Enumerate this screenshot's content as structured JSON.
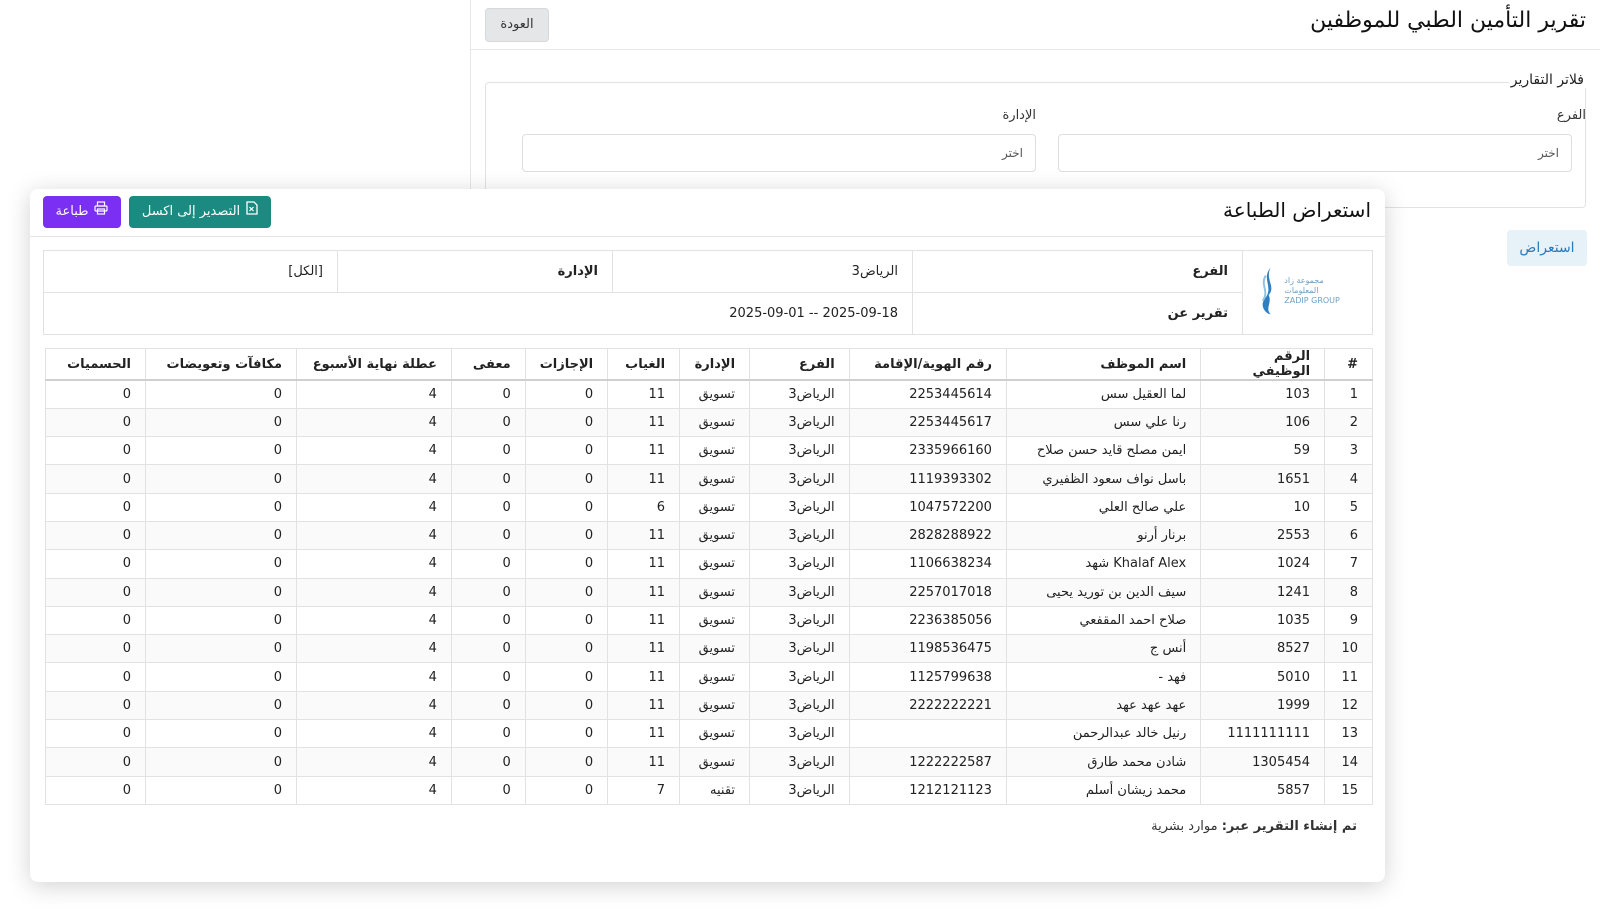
{
  "page": {
    "title": "تقرير التأمين الطبي للموظفين",
    "back_label": "العودة",
    "filters_title": "فلاتر التقارير",
    "branch_label": "الفرع",
    "branch_placeholder": "اختر",
    "department_label": "الإدارة",
    "department_placeholder": "اختر",
    "preview_label": "استعراض"
  },
  "modal": {
    "title": "استعراض الطباعة",
    "export_label": "التصدير إلى اكسل",
    "print_label": "طباعة",
    "logo_text_ar": "مجموعة زاد المعلومات",
    "logo_text_en": "ZADIP GROUP",
    "info": {
      "branch_label": "الفرع",
      "branch_value": "الرياض3",
      "department_label": "الإدارة",
      "department_value": "[الكل]",
      "report_label": "تقرير عن",
      "report_value": "2025-09-01 -- 2025-09-18"
    },
    "columns": [
      "#",
      "الرقم الوظيفي",
      "اسم الموظف",
      "رقم الهوية/الإقامة",
      "الفرع",
      "الإدارة",
      "الغياب",
      "الإجازات",
      "معفى",
      "عطلة نهاية الأسبوع",
      "مكافآت وتعويضات",
      "الحسميات"
    ],
    "rows": [
      [
        "1",
        "103",
        "لما العقيل سس",
        "2253445614",
        "الرياض3",
        "تسويق",
        "11",
        "0",
        "0",
        "4",
        "0",
        "0"
      ],
      [
        "2",
        "106",
        "رنا علي سس",
        "2253445617",
        "الرياض3",
        "تسويق",
        "11",
        "0",
        "0",
        "4",
        "0",
        "0"
      ],
      [
        "3",
        "59",
        "ايمن مصلح قايد حسن صلاح",
        "2335966160",
        "الرياض3",
        "تسويق",
        "11",
        "0",
        "0",
        "4",
        "0",
        "0"
      ],
      [
        "4",
        "1651",
        "باسل نواف سعود الظفيري",
        "1119393302",
        "الرياض3",
        "تسويق",
        "11",
        "0",
        "0",
        "4",
        "0",
        "0"
      ],
      [
        "5",
        "10",
        "علي صالح العلي",
        "1047572200",
        "الرياض3",
        "تسويق",
        "6",
        "0",
        "0",
        "4",
        "0",
        "0"
      ],
      [
        "6",
        "2553",
        "برنار أرنو",
        "2828288922",
        "الرياض3",
        "تسويق",
        "11",
        "0",
        "0",
        "4",
        "0",
        "0"
      ],
      [
        "7",
        "1024",
        "Khalaf Alex شهد",
        "1106638234",
        "الرياض3",
        "تسويق",
        "11",
        "0",
        "0",
        "4",
        "0",
        "0"
      ],
      [
        "8",
        "1241",
        "سيف الدين بن توريد يحيى",
        "2257017018",
        "الرياض3",
        "تسويق",
        "11",
        "0",
        "0",
        "4",
        "0",
        "0"
      ],
      [
        "9",
        "1035",
        "صلاح احمد المقفعي",
        "2236385056",
        "الرياض3",
        "تسويق",
        "11",
        "0",
        "0",
        "4",
        "0",
        "0"
      ],
      [
        "10",
        "8527",
        "أنس ج",
        "1198536475",
        "الرياض3",
        "تسويق",
        "11",
        "0",
        "0",
        "4",
        "0",
        "0"
      ],
      [
        "11",
        "5010",
        "فهد -",
        "1125799638",
        "الرياض3",
        "تسويق",
        "11",
        "0",
        "0",
        "4",
        "0",
        "0"
      ],
      [
        "12",
        "1999",
        "عهد عهد عهد",
        "2222222221",
        "الرياض3",
        "تسويق",
        "11",
        "0",
        "0",
        "4",
        "0",
        "0"
      ],
      [
        "13",
        "1111111111",
        "رنيل خالد عبدالرحمن",
        "",
        "الرياض3",
        "تسويق",
        "11",
        "0",
        "0",
        "4",
        "0",
        "0"
      ],
      [
        "14",
        "1305454",
        "شادن محمد طارق",
        "1222222587",
        "الرياض3",
        "تسويق",
        "11",
        "0",
        "0",
        "4",
        "0",
        "0"
      ],
      [
        "15",
        "5857",
        "محمد زيشان أسلم",
        "1212121123",
        "الرياض3",
        "تقنيه",
        "7",
        "0",
        "0",
        "4",
        "0",
        "0"
      ]
    ],
    "footer_label": "تم إنشاء التقرير عبر:",
    "footer_value": "موارد بشرية"
  },
  "colors": {
    "excel_button": "#1b8a80",
    "print_button": "#7b2ff2",
    "preview_button_bg": "#e6f1f8",
    "preview_button_text": "#2a7ab8"
  }
}
